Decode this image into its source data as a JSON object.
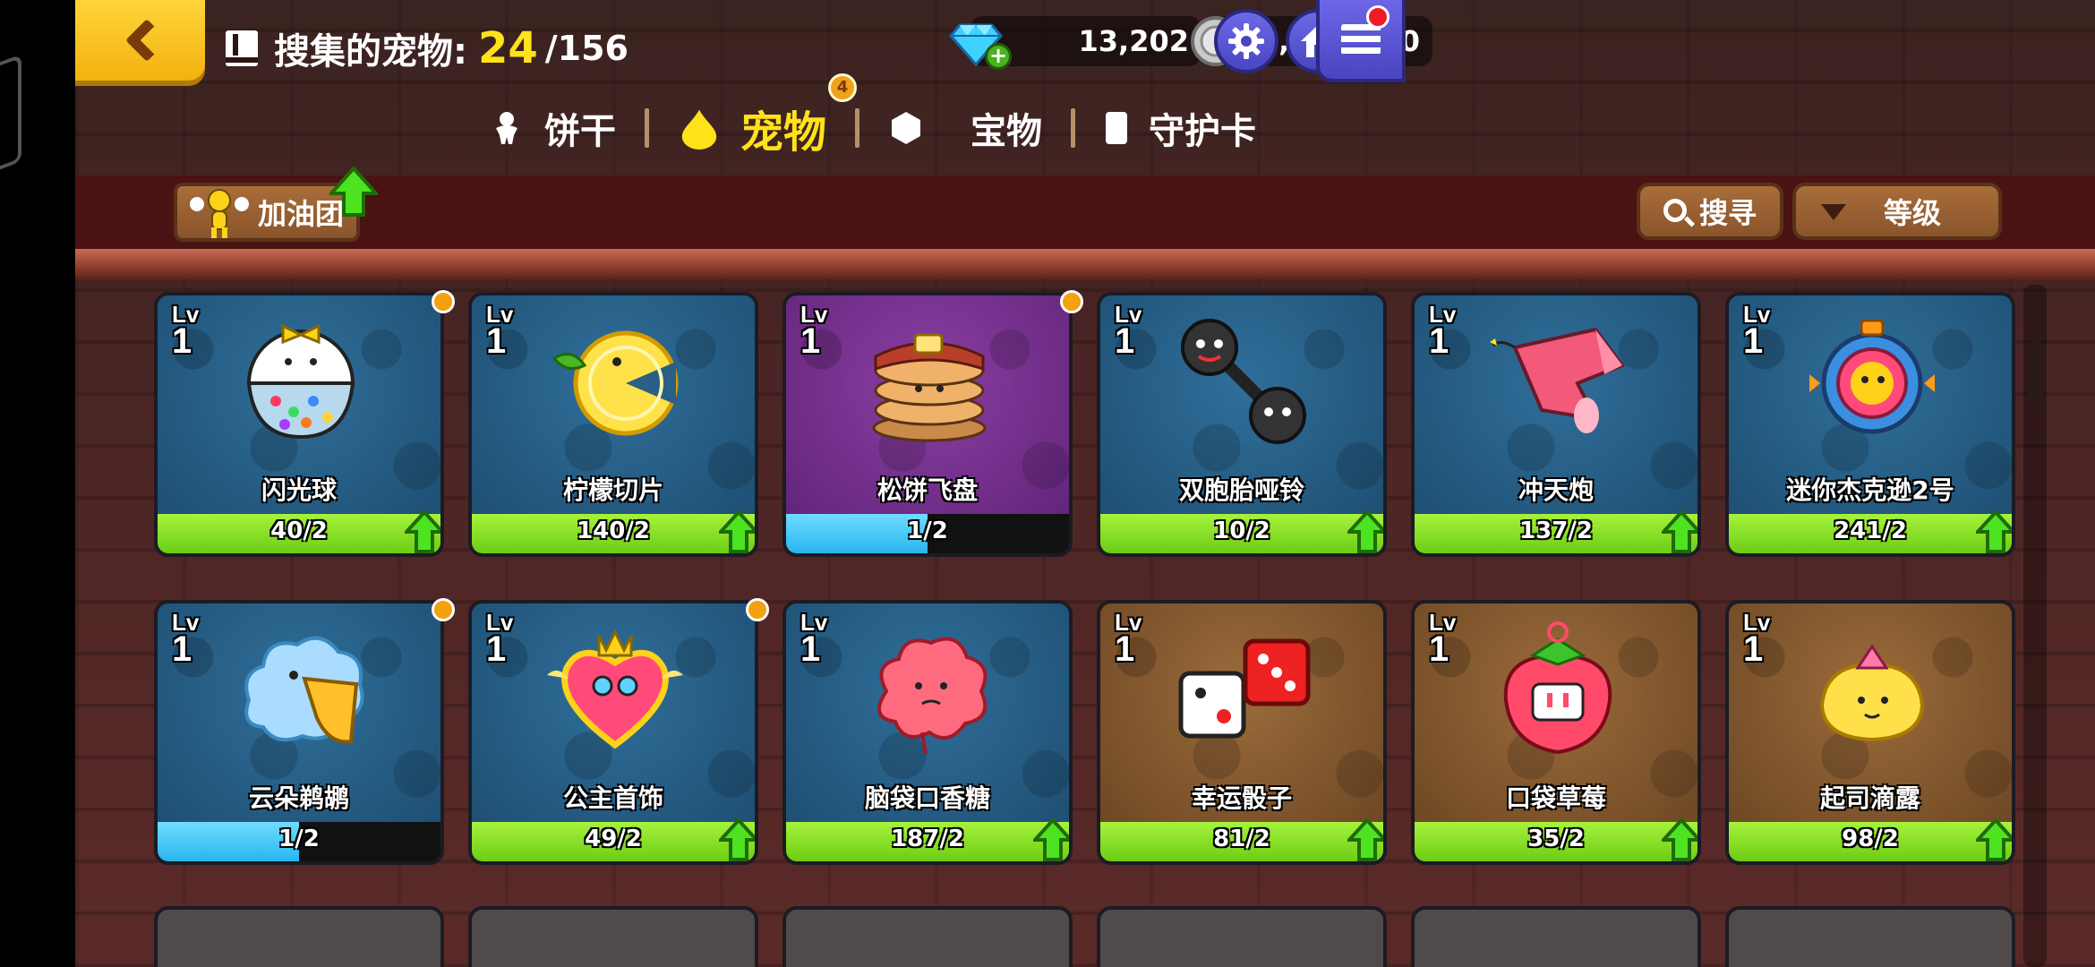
{
  "header": {
    "collect_label": "搜集的宠物:",
    "collect_count": "24",
    "collect_total": "/156",
    "gems": "13,202",
    "coins": "1,182,080"
  },
  "tabs": [
    {
      "label": "饼干",
      "icon": "cookie-icon",
      "active": false
    },
    {
      "label": "宠物",
      "icon": "pet-drop-icon",
      "active": true,
      "badge": "4"
    },
    {
      "label": "宝物",
      "icon": "treasure-icon",
      "active": false
    },
    {
      "label": "守护卡",
      "icon": "card-icon",
      "active": false
    }
  ],
  "toolbar": {
    "cheer_label": "加油团",
    "search_label": "搜寻",
    "sort_label": "等级"
  },
  "lv_label": "Lv",
  "pets": [
    {
      "name": "闪光球",
      "level": "1",
      "progress": "40/2",
      "theme": "blue",
      "bar": "green",
      "fill": 1.0,
      "dot": true,
      "up": true,
      "icon": "flash-ball-icon"
    },
    {
      "name": "柠檬切片",
      "level": "1",
      "progress": "140/2",
      "theme": "blue",
      "bar": "green",
      "fill": 1.0,
      "dot": false,
      "up": true,
      "icon": "lemon-slice-icon"
    },
    {
      "name": "松饼飞盘",
      "level": "1",
      "progress": "1/2",
      "theme": "purple",
      "bar": "cyan",
      "fill": 0.5,
      "dot": true,
      "up": false,
      "icon": "pancake-icon"
    },
    {
      "name": "双胞胎哑铃",
      "level": "1",
      "progress": "10/2",
      "theme": "blue",
      "bar": "green",
      "fill": 1.0,
      "dot": false,
      "up": true,
      "icon": "dumbbell-icon"
    },
    {
      "name": "冲天炮",
      "level": "1",
      "progress": "137/2",
      "theme": "blue",
      "bar": "green",
      "fill": 1.0,
      "dot": false,
      "up": true,
      "icon": "rocket-icon"
    },
    {
      "name": "迷你杰克逊2号",
      "level": "1",
      "progress": "241/2",
      "theme": "blue",
      "bar": "green",
      "fill": 1.0,
      "dot": false,
      "up": true,
      "icon": "mini-jackson-icon"
    },
    {
      "name": "云朵鹈鹕",
      "level": "1",
      "progress": "1/2",
      "theme": "blue",
      "bar": "cyan",
      "fill": 0.5,
      "dot": true,
      "up": false,
      "icon": "cloud-pelican-icon"
    },
    {
      "name": "公主首饰",
      "level": "1",
      "progress": "49/2",
      "theme": "blue",
      "bar": "green",
      "fill": 1.0,
      "dot": true,
      "up": true,
      "icon": "princess-heart-icon"
    },
    {
      "name": "脑袋口香糖",
      "level": "1",
      "progress": "187/2",
      "theme": "blue",
      "bar": "green",
      "fill": 1.0,
      "dot": false,
      "up": true,
      "icon": "brain-gum-icon"
    },
    {
      "name": "幸运骰子",
      "level": "1",
      "progress": "81/2",
      "theme": "brown",
      "bar": "green",
      "fill": 1.0,
      "dot": false,
      "up": true,
      "icon": "lucky-dice-icon"
    },
    {
      "name": "口袋草莓",
      "level": "1",
      "progress": "35/2",
      "theme": "brown",
      "bar": "green",
      "fill": 1.0,
      "dot": false,
      "up": true,
      "icon": "strawberry-icon"
    },
    {
      "name": "起司滴露",
      "level": "1",
      "progress": "98/2",
      "theme": "brown",
      "bar": "green",
      "fill": 1.0,
      "dot": false,
      "up": true,
      "icon": "cheese-drop-icon"
    }
  ],
  "colors": {
    "accent_yellow": "#ffe21a",
    "progress_green": "#7cd61c",
    "progress_cyan": "#3cc4f4",
    "notif_orange": "#f3a10f"
  }
}
